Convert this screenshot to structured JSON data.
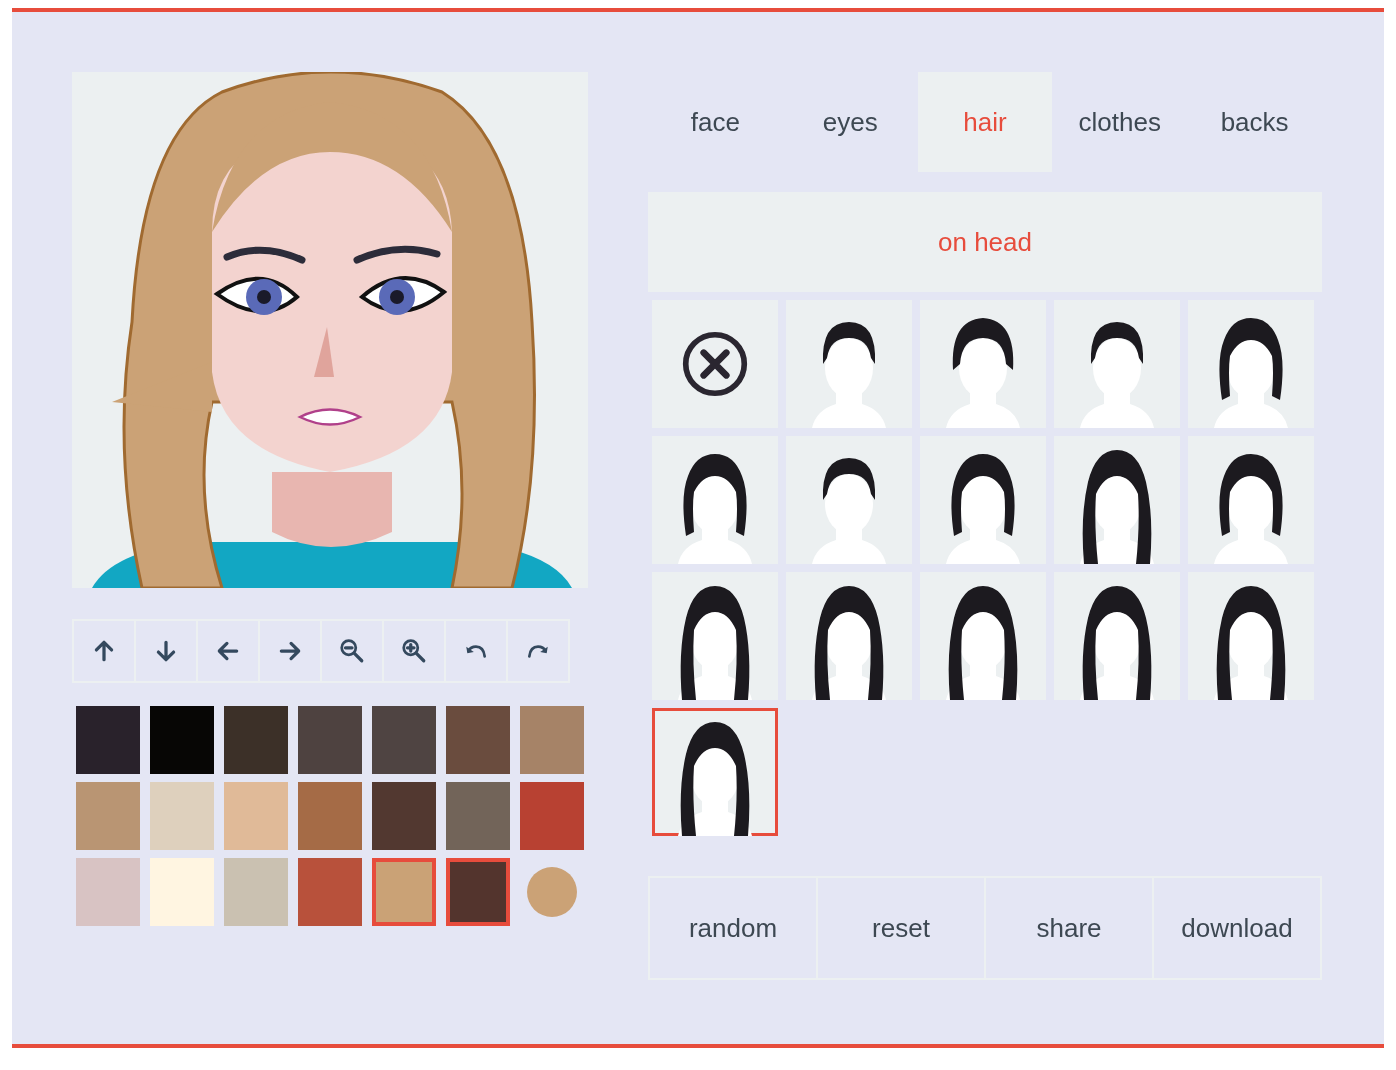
{
  "toolbar": [
    {
      "kind": "up"
    },
    {
      "kind": "down"
    },
    {
      "kind": "left"
    },
    {
      "kind": "right"
    },
    {
      "kind": "zoom-out"
    },
    {
      "kind": "zoom-in"
    },
    {
      "kind": "undo"
    },
    {
      "kind": "redo"
    }
  ],
  "swatches": [
    {
      "color": "#29222b",
      "selected": false
    },
    {
      "color": "#070605",
      "selected": false
    },
    {
      "color": "#3c3028",
      "selected": false
    },
    {
      "color": "#4e4240",
      "selected": false
    },
    {
      "color": "#4f4442",
      "selected": false
    },
    {
      "color": "#6a4c3e",
      "selected": false
    },
    {
      "color": "#a68367",
      "selected": false
    },
    {
      "color": "#b99573",
      "selected": false
    },
    {
      "color": "#ded0bd",
      "selected": false
    },
    {
      "color": "#e0ba98",
      "selected": false
    },
    {
      "color": "#a56b46",
      "selected": false
    },
    {
      "color": "#523830",
      "selected": false
    },
    {
      "color": "#726459",
      "selected": false
    },
    {
      "color": "#b84132",
      "selected": false
    },
    {
      "color": "#d8c3c3",
      "selected": false
    },
    {
      "color": "#fff5e1",
      "selected": false
    },
    {
      "color": "#cac1b1",
      "selected": false
    },
    {
      "color": "#b8513b",
      "selected": false
    },
    {
      "color": "#caa276",
      "selected": true
    },
    {
      "color": "#53342d",
      "selected": true
    }
  ],
  "current_color": {
    "color": "#cba276"
  },
  "tabs": [
    {
      "label": "face",
      "selected": false
    },
    {
      "label": "eyes",
      "selected": false
    },
    {
      "label": "hair",
      "selected": true
    },
    {
      "label": "clothes",
      "selected": false
    },
    {
      "label": "backs",
      "selected": false
    }
  ],
  "category": {
    "label": "on head"
  },
  "hairstyles": [
    {
      "kind": "none",
      "selected": false
    },
    {
      "kind": "hair",
      "selected": false
    },
    {
      "kind": "hair",
      "selected": false
    },
    {
      "kind": "hair",
      "selected": false
    },
    {
      "kind": "hair",
      "selected": false
    },
    {
      "kind": "hair",
      "selected": false
    },
    {
      "kind": "hair",
      "selected": false
    },
    {
      "kind": "hair",
      "selected": false
    },
    {
      "kind": "hair",
      "selected": false
    },
    {
      "kind": "hair",
      "selected": false
    },
    {
      "kind": "hair",
      "selected": false
    },
    {
      "kind": "hair",
      "selected": false
    },
    {
      "kind": "hair",
      "selected": false
    },
    {
      "kind": "hair",
      "selected": false
    },
    {
      "kind": "hair",
      "selected": false
    },
    {
      "kind": "hair",
      "selected": true
    }
  ],
  "buttons": [
    "random",
    "reset",
    "share",
    "download"
  ]
}
